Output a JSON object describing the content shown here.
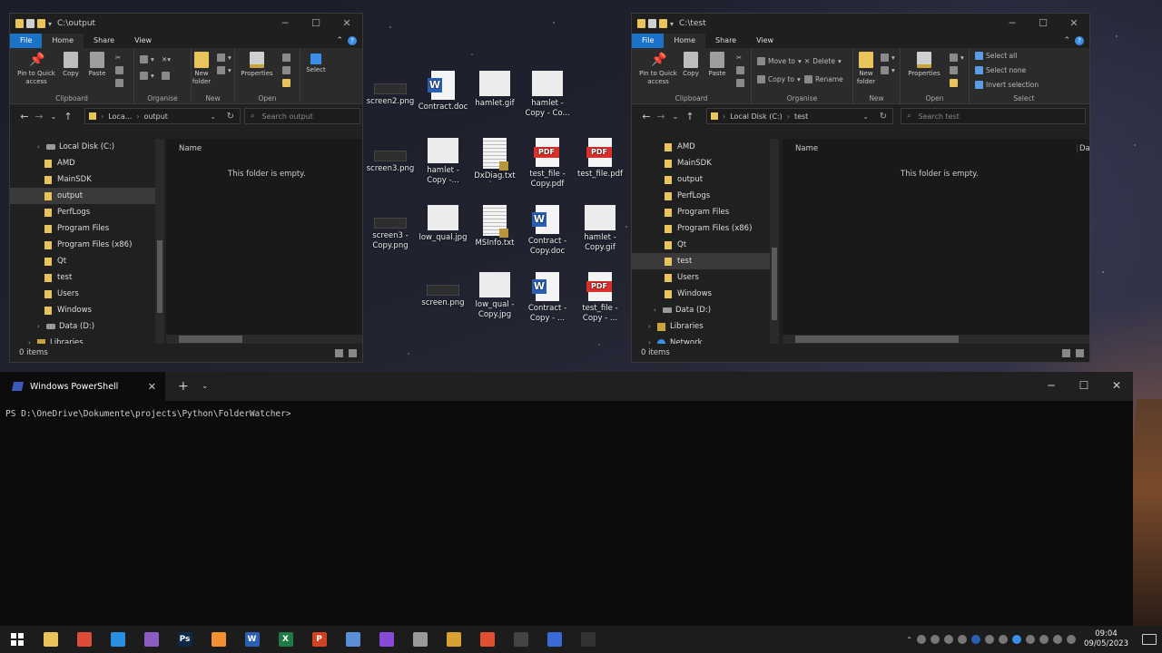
{
  "explorer_left": {
    "title": "C:\\output",
    "menu": {
      "file": "File",
      "home": "Home",
      "share": "Share",
      "view": "View"
    },
    "ribbon": {
      "pin": "Pin to Quick access",
      "copy": "Copy",
      "paste": "Paste",
      "new_folder": "New folder",
      "properties": "Properties",
      "select": "Select",
      "groups": {
        "clipboard": "Clipboard",
        "organise": "Organise",
        "new": "New",
        "open": "Open"
      }
    },
    "address": {
      "segment1": "Loca...",
      "segment2": "output"
    },
    "search_placeholder": "Search output",
    "tree": [
      {
        "label": "Local Disk (C:)",
        "kind": "drive"
      },
      {
        "label": "AMD",
        "kind": "folder"
      },
      {
        "label": "MainSDK",
        "kind": "folder"
      },
      {
        "label": "output",
        "kind": "folder",
        "selected": true
      },
      {
        "label": "PerfLogs",
        "kind": "folder"
      },
      {
        "label": "Program Files",
        "kind": "folder"
      },
      {
        "label": "Program Files (x86)",
        "kind": "folder"
      },
      {
        "label": "Qt",
        "kind": "folder"
      },
      {
        "label": "test",
        "kind": "folder"
      },
      {
        "label": "Users",
        "kind": "folder"
      },
      {
        "label": "Windows",
        "kind": "folder"
      },
      {
        "label": "Data (D:)",
        "kind": "drive"
      },
      {
        "label": "Libraries",
        "kind": "library"
      }
    ],
    "column_name": "Name",
    "empty_text": "This folder is empty.",
    "status": "0 items"
  },
  "explorer_right": {
    "title": "C:\\test",
    "menu": {
      "file": "File",
      "home": "Home",
      "share": "Share",
      "view": "View"
    },
    "ribbon": {
      "pin": "Pin to Quick access",
      "copy": "Copy",
      "paste": "Paste",
      "move_to": "Move to",
      "copy_to": "Copy to",
      "delete": "Delete",
      "rename": "Rename",
      "new_folder": "New folder",
      "properties": "Properties",
      "select_all": "Select all",
      "select_none": "Select none",
      "invert_selection": "Invert selection",
      "groups": {
        "clipboard": "Clipboard",
        "organise": "Organise",
        "new": "New",
        "open": "Open",
        "select": "Select"
      }
    },
    "address": {
      "segment1": "Local Disk (C:)",
      "segment2": "test"
    },
    "search_placeholder": "Search test",
    "tree": [
      {
        "label": "AMD",
        "kind": "folder"
      },
      {
        "label": "MainSDK",
        "kind": "folder"
      },
      {
        "label": "output",
        "kind": "folder"
      },
      {
        "label": "PerfLogs",
        "kind": "folder"
      },
      {
        "label": "Program Files",
        "kind": "folder"
      },
      {
        "label": "Program Files (x86)",
        "kind": "folder"
      },
      {
        "label": "Qt",
        "kind": "folder"
      },
      {
        "label": "test",
        "kind": "folder",
        "selected": true
      },
      {
        "label": "Users",
        "kind": "folder"
      },
      {
        "label": "Windows",
        "kind": "folder"
      },
      {
        "label": "Data (D:)",
        "kind": "drive"
      },
      {
        "label": "Libraries",
        "kind": "library"
      },
      {
        "label": "Network",
        "kind": "network"
      }
    ],
    "column_name": "Name",
    "column_date": "Dat",
    "empty_text": "This folder is empty.",
    "status": "0 items"
  },
  "desktop_icons": [
    {
      "label": "screen2.png",
      "kind": "dark"
    },
    {
      "label": "Contract.doc",
      "kind": "word"
    },
    {
      "label": "hamlet.gif",
      "kind": "img"
    },
    {
      "label": "hamlet - Copy - Co...",
      "kind": "img"
    },
    {
      "label": "screen3.png",
      "kind": "dark"
    },
    {
      "label": "hamlet - Copy -...",
      "kind": "img"
    },
    {
      "label": "DxDiag.txt",
      "kind": "txt"
    },
    {
      "label": "test_file - Copy.pdf",
      "kind": "pdf"
    },
    {
      "label": "test_file.pdf",
      "kind": "pdf"
    },
    {
      "label": "screen3 - Copy.png",
      "kind": "dark"
    },
    {
      "label": "low_qual.jpg",
      "kind": "img"
    },
    {
      "label": "MSInfo.txt",
      "kind": "txt"
    },
    {
      "label": "Contract - Copy.doc",
      "kind": "word"
    },
    {
      "label": "hamlet - Copy.gif",
      "kind": "img"
    },
    {
      "label": "screen.png",
      "kind": "dark"
    },
    {
      "label": "low_qual - Copy.jpg",
      "kind": "img"
    },
    {
      "label": "Contract - Copy - ...",
      "kind": "word"
    },
    {
      "label": "test_file - Copy - ...",
      "kind": "pdf"
    }
  ],
  "terminal": {
    "tab_title": "Windows PowerShell",
    "add_tab": "+",
    "prompt": "PS D:\\OneDrive\\Dokumente\\projects\\Python\\FolderWatcher>"
  },
  "taskbar": {
    "apps": [
      {
        "name": "file-explorer",
        "glyph": "",
        "color": "#e8c45a"
      },
      {
        "name": "chrome",
        "glyph": "",
        "color": "#dd4b39"
      },
      {
        "name": "vscode",
        "glyph": "",
        "color": "#2b8fe0"
      },
      {
        "name": "visual-studio",
        "glyph": "",
        "color": "#8a5cc4"
      },
      {
        "name": "photoshop",
        "glyph": "Ps",
        "color": "#0b2a4a"
      },
      {
        "name": "sublime",
        "glyph": "",
        "color": "#f09030"
      },
      {
        "name": "word",
        "glyph": "W",
        "color": "#2b5fb4"
      },
      {
        "name": "excel",
        "glyph": "X",
        "color": "#1e7b45"
      },
      {
        "name": "powerpoint",
        "glyph": "P",
        "color": "#d04423"
      },
      {
        "name": "droplet",
        "glyph": "",
        "color": "#5a8fd8"
      },
      {
        "name": "firefox",
        "glyph": "",
        "color": "#8a4ad8"
      },
      {
        "name": "inkscape",
        "glyph": "",
        "color": "#9a9a9a"
      },
      {
        "name": "pycharm",
        "glyph": "",
        "color": "#d8a030"
      },
      {
        "name": "git",
        "glyph": "",
        "color": "#e05030"
      },
      {
        "name": "terminal",
        "glyph": "",
        "color": "#444444"
      },
      {
        "name": "security",
        "glyph": "",
        "color": "#3a6ad8"
      },
      {
        "name": "obs",
        "glyph": "",
        "color": "#333333"
      }
    ],
    "time": "09:04",
    "date": "09/05/2023"
  }
}
